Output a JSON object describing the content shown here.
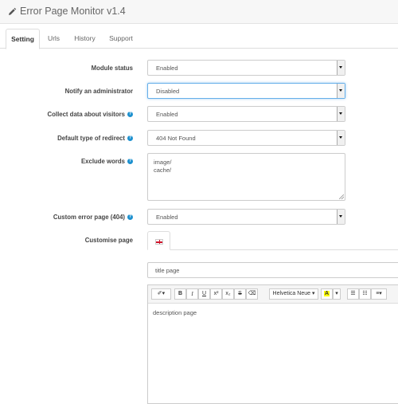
{
  "header": {
    "title": "Error Page Monitor v1.4",
    "icon": "pencil-icon"
  },
  "tabs": [
    {
      "label": "Setting",
      "active": true
    },
    {
      "label": "Urls",
      "active": false
    },
    {
      "label": "History",
      "active": false
    },
    {
      "label": "Support",
      "active": false
    }
  ],
  "form": {
    "module_status": {
      "label": "Module status",
      "value": "Enabled"
    },
    "notify_admin": {
      "label": "Notify an administrator",
      "value": "Disabled"
    },
    "collect_data": {
      "label": "Collect data about visitors",
      "value": "Enabled"
    },
    "redirect_type": {
      "label": "Default type of redirect",
      "value": "404 Not Found"
    },
    "exclude_words": {
      "label": "Exclude words",
      "value": "image/\ncache/"
    },
    "custom_error_page": {
      "label": "Custom error page (404)",
      "value": "Enabled"
    },
    "customise_page": {
      "label": "Customise page",
      "language_icon": "uk-flag-icon"
    },
    "help_icon": "?"
  },
  "page_title_input": {
    "value": "title page"
  },
  "editor": {
    "font_name": "Helvetica Neue",
    "toolbar": {
      "magic": "✐▾",
      "bold": "B",
      "italic": "I",
      "underline": "U",
      "superscript": "x²",
      "subscript": "x₂",
      "strikethrough": "S",
      "eraser": "⌫",
      "font_color": "A",
      "dropdown": "▾",
      "unordered_list": "☰",
      "ordered_list": "☷",
      "align": "≡▾"
    },
    "body": "description page"
  },
  "colors": {
    "help": "#1e91cf",
    "focus": "#66afe9",
    "flag_red": "#cf142b",
    "font_color_yellow": "#ffff00"
  }
}
